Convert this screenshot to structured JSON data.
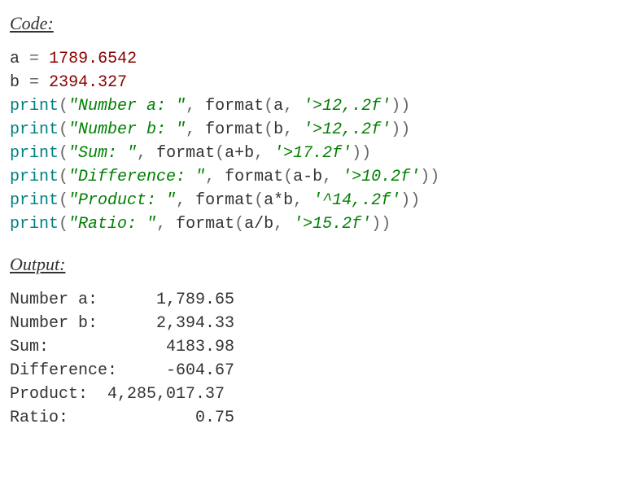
{
  "headings": {
    "code": "Code:",
    "output": "Output:"
  },
  "code": {
    "line1": {
      "a": "a",
      "eq": "=",
      "val": "1789.6542"
    },
    "line2": {
      "b": "b",
      "eq": "=",
      "val": "2394.327"
    },
    "line3": {
      "fn": "print",
      "lp": "(",
      "s": "\"Number a: \"",
      "comma": ",",
      "fmt": "format",
      "lp2": "(",
      "arg": "a",
      "comma2": ",",
      "spec": "'>12,.2f'",
      "rp": "))"
    },
    "line4": {
      "fn": "print",
      "lp": "(",
      "s": "\"Number b: \"",
      "comma": ",",
      "fmt": "format",
      "lp2": "(",
      "arg": "b",
      "comma2": ",",
      "spec": "'>12,.2f'",
      "rp": "))"
    },
    "line5": {
      "fn": "print",
      "lp": "(",
      "s": "\"Sum: \"",
      "comma": ",",
      "fmt": "format",
      "lp2": "(",
      "arg": "a+b",
      "comma2": ",",
      "spec": "'>17.2f'",
      "rp": "))"
    },
    "line6": {
      "fn": "print",
      "lp": "(",
      "s": "\"Difference: \"",
      "comma": ",",
      "fmt": "format",
      "lp2": "(",
      "arg": "a-b",
      "comma2": ",",
      "spec": "'>10.2f'",
      "rp": "))"
    },
    "line7": {
      "fn": "print",
      "lp": "(",
      "s": "\"Product: \"",
      "comma": ",",
      "fmt": "format",
      "lp2": "(",
      "arg": "a*b",
      "comma2": ",",
      "spec": "'^14,.2f'",
      "rp": "))"
    },
    "line8": {
      "fn": "print",
      "lp": "(",
      "s": "\"Ratio: \"",
      "comma": ",",
      "fmt": "format",
      "lp2": "(",
      "arg": "a/b",
      "comma2": ",",
      "spec": "'>15.2f'",
      "rp": "))"
    }
  },
  "output_lines": {
    "l1": "Number a:      1,789.65",
    "l2": "Number b:      2,394.33",
    "l3": "Sum:            4183.98",
    "l4": "Difference:     -604.67",
    "l5": "Product:  4,285,017.37 ",
    "l6": "Ratio:             0.75"
  }
}
